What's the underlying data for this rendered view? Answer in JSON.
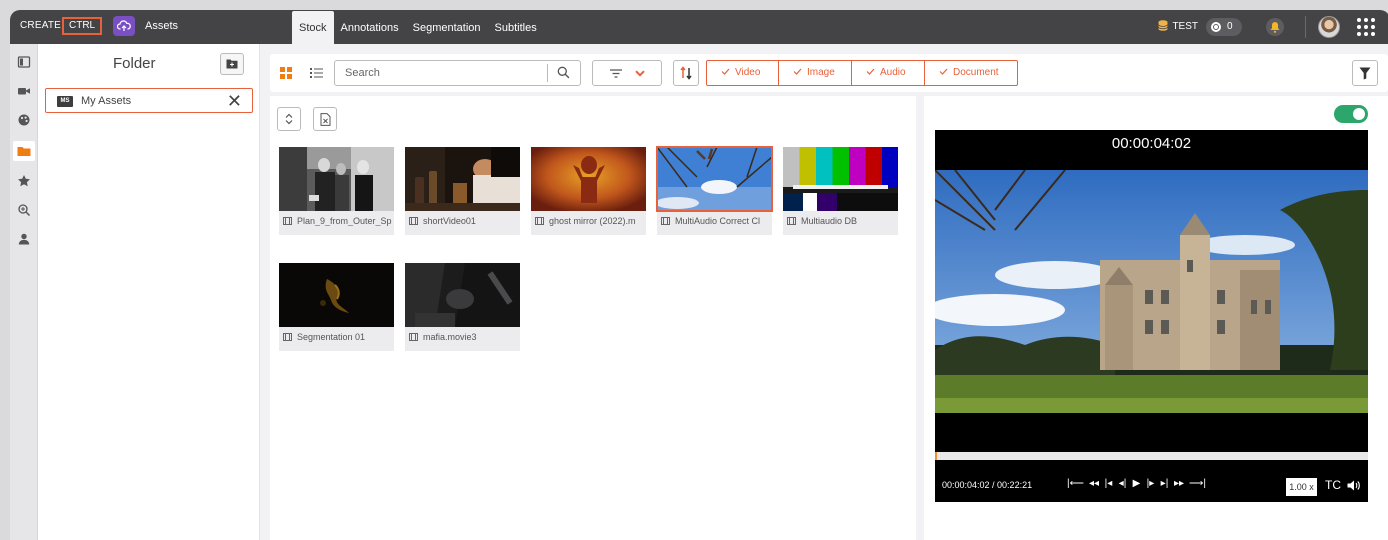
{
  "app": {
    "brand": "CREATE",
    "ctrl": "CTRL",
    "section": "Assets"
  },
  "tabs": [
    {
      "label": "Stock",
      "active": true
    },
    {
      "label": "Annotations",
      "active": false
    },
    {
      "label": "Segmentation",
      "active": false
    },
    {
      "label": "Subtitles",
      "active": false
    }
  ],
  "topright": {
    "workspace": "TEST",
    "notification_count": "0"
  },
  "folder_panel": {
    "title": "Folder",
    "selected_folder": {
      "badge": "MS",
      "label": "My Assets"
    }
  },
  "toolbar": {
    "search_placeholder": "Search",
    "search_value": "",
    "types": [
      "Video",
      "Image",
      "Audio",
      "Document"
    ]
  },
  "assets": [
    {
      "name": "Plan_9_from_Outer_Sp",
      "selected": false
    },
    {
      "name": "shortVideo01",
      "selected": false
    },
    {
      "name": "ghost mirror (2022).m",
      "selected": false
    },
    {
      "name": "MultiAudio Correct Cl",
      "selected": true
    },
    {
      "name": "Multiaudio DB",
      "selected": false
    },
    {
      "name": "Segmentation 01",
      "selected": false
    },
    {
      "name": "mafia.movie3",
      "selected": false
    }
  ],
  "player": {
    "timecode": "00:00:04:02",
    "time_display": "00:00:04:02 / 00:22:21",
    "progress": 0.003,
    "speed": "1.00 x",
    "tc_label": "TC"
  },
  "colors": {
    "accent": "#e8613a",
    "topbar": "#444447",
    "toggle_on": "#2da66b",
    "assets_icon": "#7b4fc4"
  },
  "icons": [
    "cloud-upload-icon",
    "database-icon",
    "record-icon",
    "bell-icon",
    "apps-grid-icon",
    "search-icon",
    "filter-icon",
    "sort-icon",
    "funnel-icon",
    "check-icon",
    "film-icon",
    "folder-plus-icon",
    "close-icon"
  ]
}
